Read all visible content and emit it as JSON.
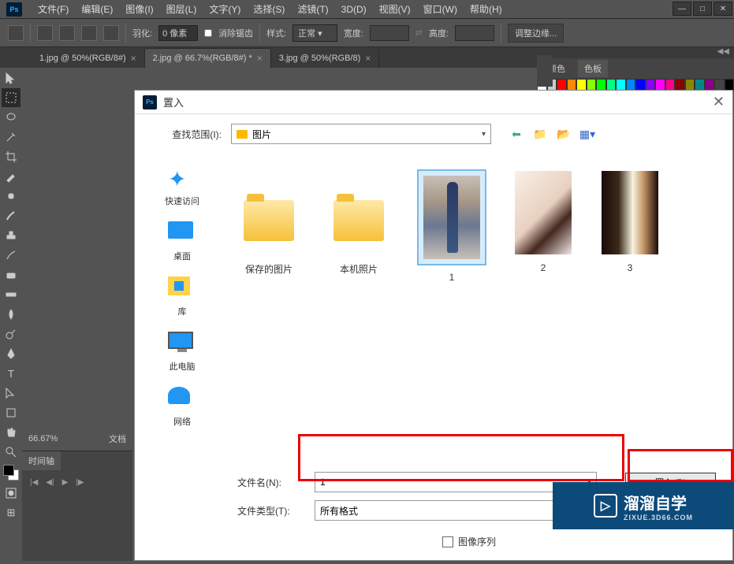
{
  "menubar": {
    "items": [
      "文件(F)",
      "编辑(E)",
      "图像(I)",
      "图层(L)",
      "文字(Y)",
      "选择(S)",
      "滤镜(T)",
      "3D(D)",
      "视图(V)",
      "窗口(W)",
      "帮助(H)"
    ]
  },
  "options": {
    "feather_label": "羽化:",
    "feather_value": "0 像素",
    "antialias_label": "消除锯齿",
    "style_label": "样式:",
    "style_value": "正常",
    "width_label": "宽度:",
    "height_label": "高度:",
    "refine_label": "调整边缘..."
  },
  "tabs": [
    {
      "label": "1.jpg @ 50%(RGB/8#)",
      "active": false
    },
    {
      "label": "2.jpg @ 66.7%(RGB/8#) *",
      "active": true
    },
    {
      "label": "3.jpg @ 50%(RGB/8)",
      "active": false
    }
  ],
  "status": {
    "zoom": "66.67%",
    "doc": "文档"
  },
  "timeline": {
    "tab": "时间轴"
  },
  "right_panel": {
    "tabs": [
      "颜色",
      "色板"
    ]
  },
  "dialog": {
    "title": "置入",
    "lookin_label": "查找范围(I):",
    "lookin_value": "图片",
    "places": [
      {
        "label": "快速访问",
        "icon": "star"
      },
      {
        "label": "桌面",
        "icon": "desktop"
      },
      {
        "label": "库",
        "icon": "lib"
      },
      {
        "label": "此电脑",
        "icon": "pc"
      },
      {
        "label": "网络",
        "icon": "net"
      }
    ],
    "files": [
      {
        "label": "保存的图片",
        "type": "folder"
      },
      {
        "label": "本机照片",
        "type": "folder"
      },
      {
        "label": "1",
        "type": "image",
        "selected": true
      },
      {
        "label": "2",
        "type": "image"
      },
      {
        "label": "3",
        "type": "image"
      }
    ],
    "filename_label": "文件名(N):",
    "filename_value": "1",
    "filetype_label": "文件类型(T):",
    "filetype_value": "所有格式",
    "place_btn": "置入(P)",
    "sequence_label": "图像序列"
  },
  "watermark": {
    "text": "溜溜自学",
    "sub": "ZIXUE.3D66.COM"
  }
}
